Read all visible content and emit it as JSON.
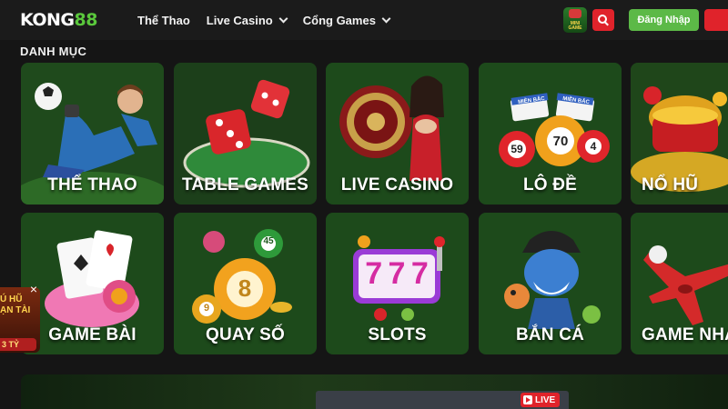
{
  "header": {
    "logo_main": "KONG",
    "logo_accent": "88",
    "nav": [
      {
        "label": "Thể Thao",
        "has_dropdown": false
      },
      {
        "label": "Live Casino",
        "has_dropdown": true
      },
      {
        "label": "Cổng Games",
        "has_dropdown": true
      }
    ],
    "minigame_label": "MINI GAME",
    "search_icon": "search-icon",
    "login_label": "Đăng Nhập",
    "brand_green": "#5cb947",
    "brand_red": "#e0232b"
  },
  "category_title": "DANH MỤC",
  "categories": [
    {
      "label": "THỂ THAO",
      "icon": "soccer-goalkeeper"
    },
    {
      "label": "TABLE GAMES",
      "icon": "dice"
    },
    {
      "label": "LIVE CASINO",
      "icon": "roulette-dealer"
    },
    {
      "label": "LÔ ĐỀ",
      "icon": "lottery-balls"
    },
    {
      "label": "NỔ HŨ",
      "icon": "gold-pot"
    },
    {
      "label": "GAME BÀI",
      "icon": "playing-cards"
    },
    {
      "label": "QUAY SỐ",
      "icon": "lottery-balls"
    },
    {
      "label": "SLOTS",
      "icon": "slot-machine"
    },
    {
      "label": "BẮN CÁ",
      "icon": "shark-pirate"
    },
    {
      "label": "GAME NHA",
      "icon": "airplane"
    }
  ],
  "lottery_balls": [
    "59",
    "70",
    "4"
  ],
  "lottery_tags": [
    "MIỀN BẮC",
    "MIỀN BẮC"
  ],
  "quay_so_balls": [
    "45",
    "8",
    "9"
  ],
  "slot_digits": [
    "7",
    "7",
    "7"
  ],
  "promo": {
    "line1": "Ú HŨ",
    "line2": "ẠN TÀI",
    "amount": "3 TỶ",
    "close": "×"
  },
  "banner": {
    "live_label": "LIVE"
  }
}
